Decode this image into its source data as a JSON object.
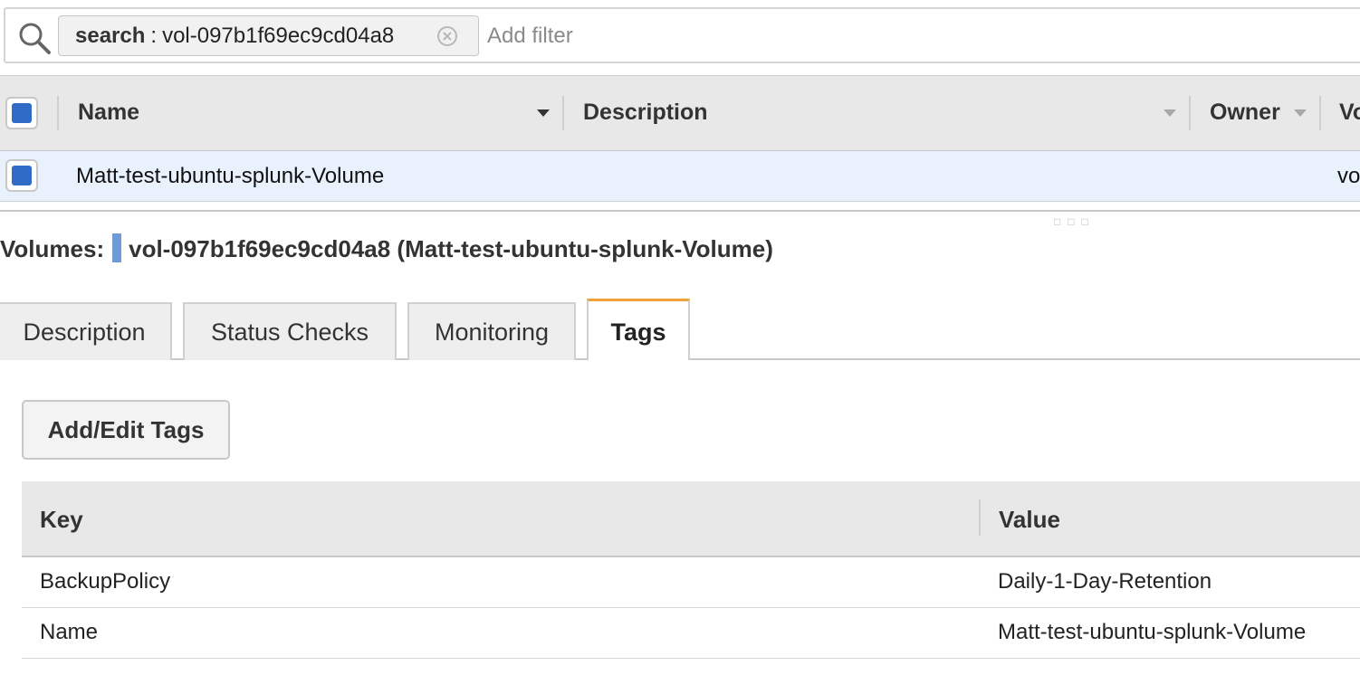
{
  "search": {
    "token_key": "search",
    "token_sep": ":",
    "token_value": "vol-097b1f69ec9cd04a8",
    "placeholder": "Add filter"
  },
  "grid": {
    "columns": [
      "Name",
      "Description",
      "Owner",
      "Vo"
    ],
    "row": {
      "name": "Matt-test-ubuntu-splunk-Volume",
      "volume_id_partial": "vo"
    }
  },
  "detail": {
    "label": "Volumes:",
    "title": "vol-097b1f69ec9cd04a8 (Matt-test-ubuntu-splunk-Volume)"
  },
  "tabs": [
    {
      "label": "Description",
      "active": false
    },
    {
      "label": "Status Checks",
      "active": false
    },
    {
      "label": "Monitoring",
      "active": false
    },
    {
      "label": "Tags",
      "active": true
    }
  ],
  "tags": {
    "edit_button": "Add/Edit Tags",
    "headers": {
      "key": "Key",
      "value": "Value"
    },
    "rows": [
      {
        "key": "BackupPolicy",
        "value": "Daily-1-Day-Retention"
      },
      {
        "key": "Name",
        "value": "Matt-test-ubuntu-splunk-Volume"
      }
    ]
  },
  "colors": {
    "accent_tab": "#f0a33c",
    "checkbox": "#2f6bc6",
    "selected_row": "#e9f2fc"
  }
}
